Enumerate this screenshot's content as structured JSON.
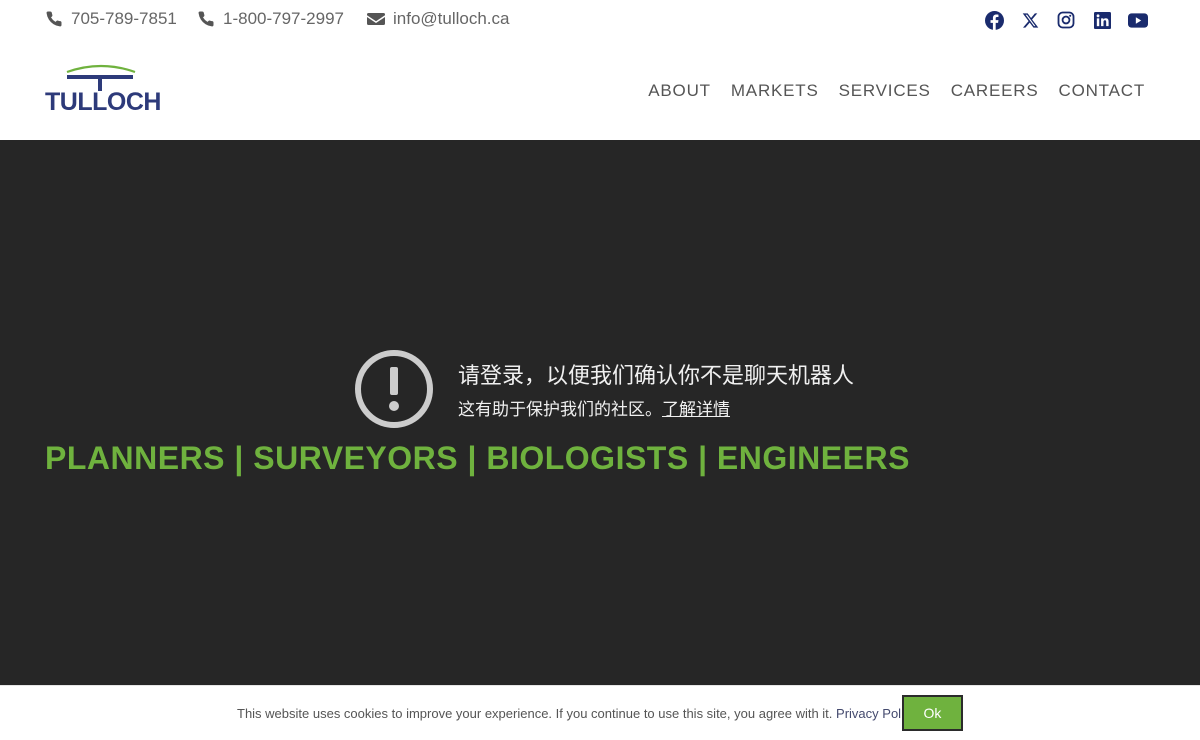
{
  "contacts": {
    "phone1": "705-789-7851",
    "phone2": "1-800-797-2997",
    "email": "info@tulloch.ca"
  },
  "social": [
    "facebook-icon",
    "x-icon",
    "instagram-icon",
    "linkedin-icon",
    "youtube-icon"
  ],
  "brand": {
    "name": "TULLOCH",
    "logo_color": "#2d3a7a",
    "accent": "#6fb23e"
  },
  "nav": {
    "items": [
      {
        "label": "ABOUT"
      },
      {
        "label": "MARKETS"
      },
      {
        "label": "SERVICES"
      },
      {
        "label": "CAREERS"
      },
      {
        "label": "CONTACT"
      }
    ]
  },
  "hero": {
    "alert_title": "请登录，以便我们确认你不是聊天机器人",
    "alert_sub": "这有助于保护我们的社区。",
    "alert_link": "了解详情",
    "tagline": "PLANNERS | SURVEYORS | BIOLOGISTS | ENGINEERS"
  },
  "cookie": {
    "text": "This website uses cookies to improve your experience. If you continue to use this site, you agree with it.",
    "link": "Privacy Policy",
    "button": "Ok"
  }
}
